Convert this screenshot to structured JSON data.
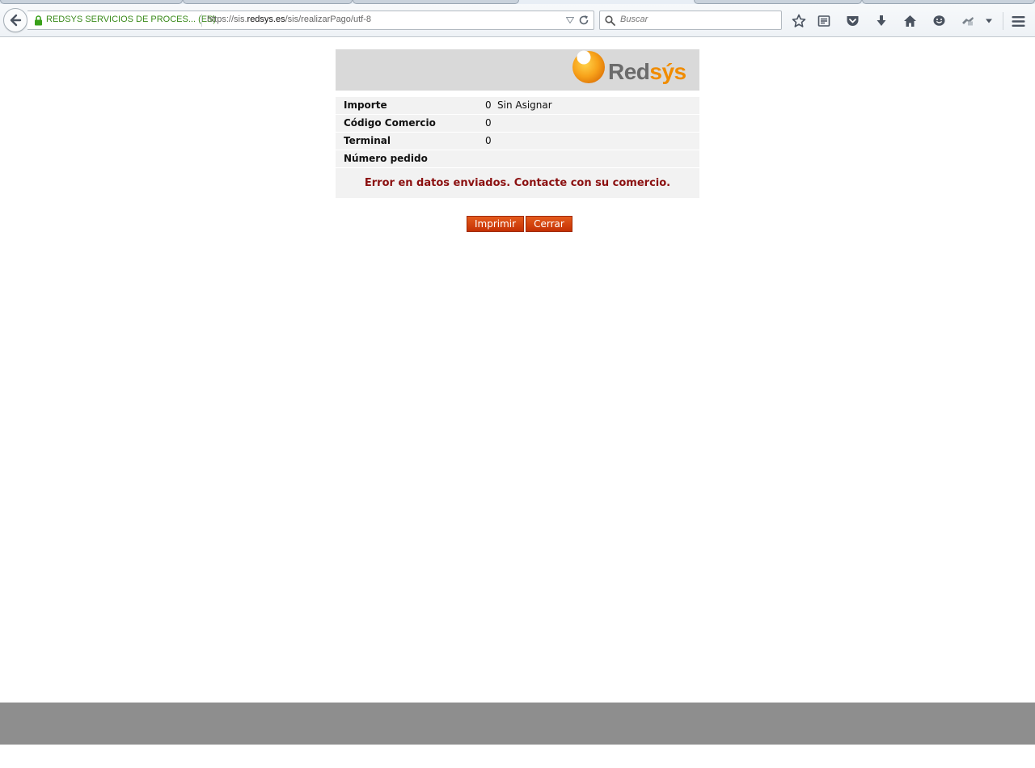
{
  "browser": {
    "site_identity": "REDSYS SERVICIOS DE PROCES... (ES)",
    "url_prefix": "https://sis.",
    "url_domain": "redsys.es",
    "url_path": "/sis/realizarPago/utf-8",
    "search_placeholder": "Buscar",
    "icons": [
      "back-arrow-icon",
      "lock-icon",
      "dropmarker-icon",
      "reload-icon",
      "search-icon",
      "bookmark-star-icon",
      "reading-list-icon",
      "pocket-icon",
      "download-icon",
      "home-icon",
      "chat-icon",
      "extension-icon",
      "menu-dropdown-icon",
      "hamburger-menu-icon"
    ]
  },
  "page": {
    "logo_text_red": "Red",
    "logo_text_sys": "sýs",
    "rows": [
      {
        "label": "Importe",
        "value": "0",
        "extra": "Sin Asignar"
      },
      {
        "label": "Código Comercio",
        "value": "0",
        "extra": ""
      },
      {
        "label": "Terminal",
        "value": "0",
        "extra": ""
      },
      {
        "label": "Número pedido",
        "value": "",
        "extra": ""
      }
    ],
    "error_message": "Error en datos enviados. Contacte con su comercio.",
    "print_button": "Imprimir",
    "close_button": "Cerrar"
  },
  "colors": {
    "accent": "#d13f0a",
    "error_text": "#8b1010",
    "banner_bg": "#d9d9d9",
    "logo_orange": "#f39200",
    "footer": "#8e8e8e"
  }
}
